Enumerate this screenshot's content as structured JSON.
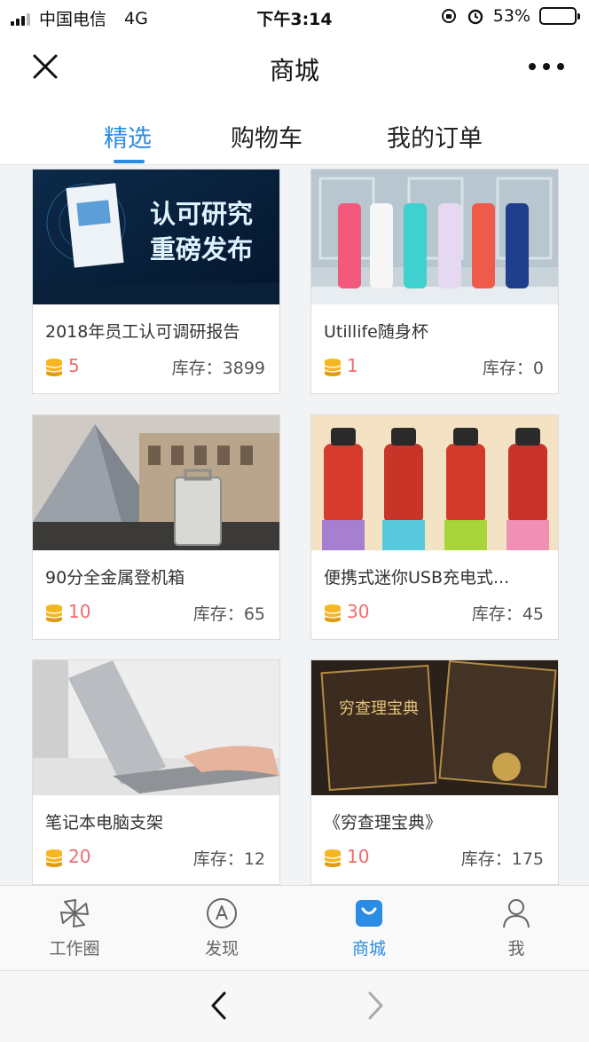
{
  "status": {
    "carrier": "中国电信",
    "network": "4G",
    "time": "下午3:14",
    "battery_percent": "53%",
    "battery_level": 0.53
  },
  "nav": {
    "title": "商城"
  },
  "tabs": [
    {
      "label": "精选",
      "active": true
    },
    {
      "label": "购物车",
      "active": false
    },
    {
      "label": "我的订单",
      "active": false
    }
  ],
  "stock_label": "库存：",
  "products": [
    {
      "name": "2018年员工认可调研报告",
      "price": "5",
      "stock": "3899",
      "image_text_line1": "认可研究",
      "image_text_line2": "重磅发布"
    },
    {
      "name": "Utillife随身杯",
      "price": "1",
      "stock": "0"
    },
    {
      "name": "90分全金属登机箱",
      "price": "10",
      "stock": "65"
    },
    {
      "name": "便携式迷你USB充电式...",
      "price": "30",
      "stock": "45"
    },
    {
      "name": "笔记本电脑支架",
      "price": "20",
      "stock": "12"
    },
    {
      "name": "《穷查理宝典》",
      "price": "10",
      "stock": "175",
      "image_text": "穷查理宝典"
    }
  ],
  "tabbar": [
    {
      "label": "工作圈",
      "icon": "pinwheel-icon",
      "active": false
    },
    {
      "label": "发现",
      "icon": "compass-icon",
      "active": false
    },
    {
      "label": "商城",
      "icon": "shopping-bag-icon",
      "active": true
    },
    {
      "label": "我",
      "icon": "person-icon",
      "active": false
    }
  ],
  "colors": {
    "accent": "#2b8ce3",
    "price": "#f26b6b",
    "coin": "#f5b622"
  }
}
